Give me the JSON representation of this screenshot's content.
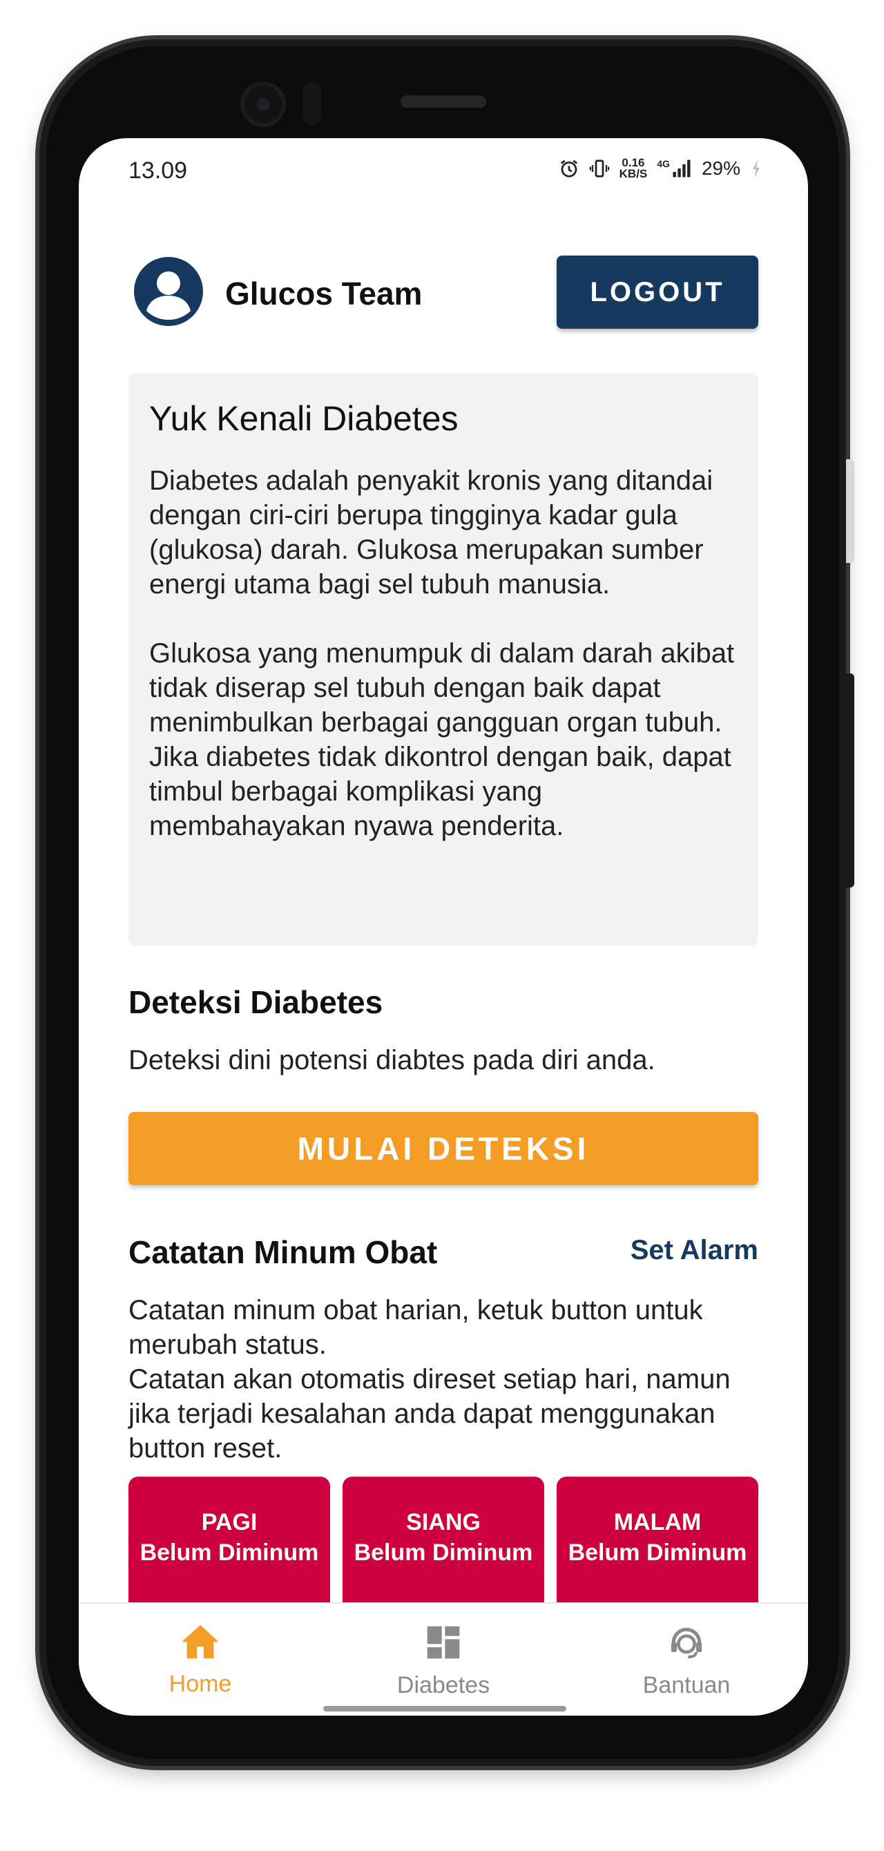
{
  "status_bar": {
    "time": "13.09",
    "net_speed_value": "0.16",
    "net_speed_unit": "KB/S",
    "network_type": "4G",
    "battery": "29%",
    "icons": [
      "alarm-icon",
      "vibrate-icon",
      "signal-icon",
      "charging-icon"
    ]
  },
  "header": {
    "user_name": "Glucos Team",
    "logout_label": "LOGOUT"
  },
  "info": {
    "title": "Yuk Kenali Diabetes",
    "paragraph_1": "Diabetes adalah penyakit kronis yang ditandai dengan ciri-ciri berupa tingginya kadar gula (glukosa) darah. Glukosa merupakan sumber energi utama bagi sel tubuh manusia.",
    "paragraph_2": "Glukosa yang menumpuk di dalam darah akibat tidak diserap sel tubuh dengan baik dapat menimbulkan berbagai gangguan organ tubuh. Jika diabetes tidak dikontrol dengan baik, dapat timbul berbagai komplikasi yang membahayakan nyawa penderita."
  },
  "deteksi": {
    "title": "Deteksi Diabetes",
    "description": "Deteksi dini potensi diabtes pada diri anda.",
    "button_label": "MULAI DETEKSI"
  },
  "catatan": {
    "title": "Catatan Minum Obat",
    "set_alarm_label": "Set Alarm",
    "description_1": "Catatan minum obat harian, ketuk button untuk merubah status.",
    "description_2": "Catatan akan otomatis direset setiap hari, namun jika terjadi kesalahan anda dapat menggunakan button reset.",
    "times": [
      {
        "label": "PAGI",
        "status": "Belum Diminum"
      },
      {
        "label": "SIANG",
        "status": "Belum Diminum"
      },
      {
        "label": "MALAM",
        "status": "Belum Diminum"
      }
    ]
  },
  "bottom_nav": [
    {
      "label": "Home",
      "icon": "home-icon",
      "active": true
    },
    {
      "label": "Diabetes",
      "icon": "dashboard-icon",
      "active": false
    },
    {
      "label": "Bantuan",
      "icon": "support-agent-icon",
      "active": false
    }
  ],
  "colors": {
    "primary": "#163a5f",
    "accent": "#f59c27",
    "danger": "#cf0040",
    "card_bg": "#f2f2f2"
  }
}
